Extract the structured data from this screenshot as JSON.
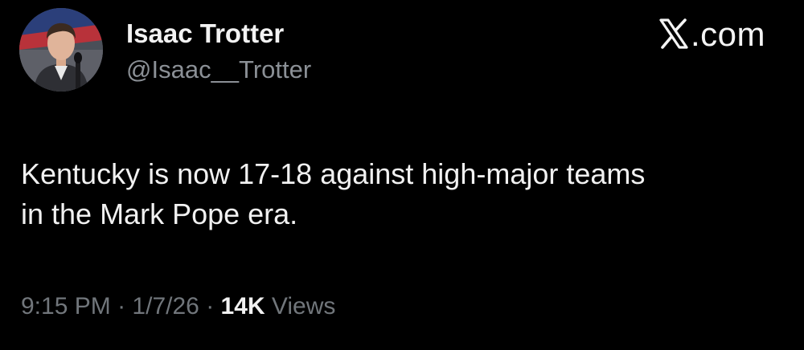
{
  "author": {
    "display_name": "Isaac Trotter",
    "handle": "@Isaac__Trotter"
  },
  "brand": {
    "label": ".com",
    "logo": "x-logo-icon"
  },
  "tweet": {
    "text_line1": "Kentucky is now 17-18 against high-major teams",
    "text_line2": "in the Mark Pope era."
  },
  "meta": {
    "time": "9:15 PM",
    "separator": "·",
    "date": "1/7/26",
    "views_count": "14K",
    "views_label": "Views"
  },
  "colors": {
    "background": "#000000",
    "primary_text": "#f1f1f1",
    "secondary_text": "#71767b"
  }
}
